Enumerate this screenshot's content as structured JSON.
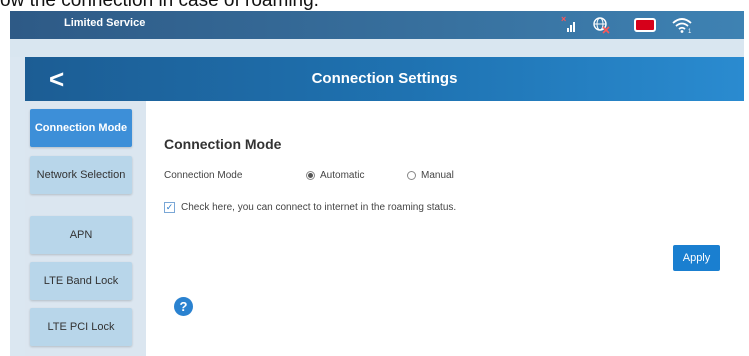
{
  "caption": "ow the connection in case of roaming.",
  "status_bar": {
    "text": "Limited Service",
    "icons": [
      "signal-icon",
      "globe-icon",
      "sim-card-icon",
      "wifi-icon"
    ]
  },
  "header": {
    "title": "Connection Settings",
    "back_glyph": "<"
  },
  "sidebar": {
    "items": [
      {
        "label": "Connection Mode",
        "active": true
      },
      {
        "label": "Network Selection",
        "active": false
      },
      {
        "label": "APN",
        "active": false
      },
      {
        "label": "LTE Band Lock",
        "active": false
      },
      {
        "label": "LTE PCI Lock",
        "active": false
      }
    ]
  },
  "main": {
    "section_title": "Connection Mode",
    "mode_label": "Connection Mode",
    "options": [
      {
        "label": "Automatic",
        "selected": true
      },
      {
        "label": "Manual",
        "selected": false
      }
    ],
    "roaming_checkbox": {
      "checked": true,
      "label": "Check here, you can connect to internet in the roaming status."
    },
    "apply_label": "Apply",
    "help_glyph": "?"
  },
  "colors": {
    "header_blue": "#1f73b2",
    "active_nav": "#3d8fd8",
    "inactive_nav": "#b8d6ea",
    "apply_button": "#1a7fd0",
    "sim_red": "#d6001a"
  }
}
